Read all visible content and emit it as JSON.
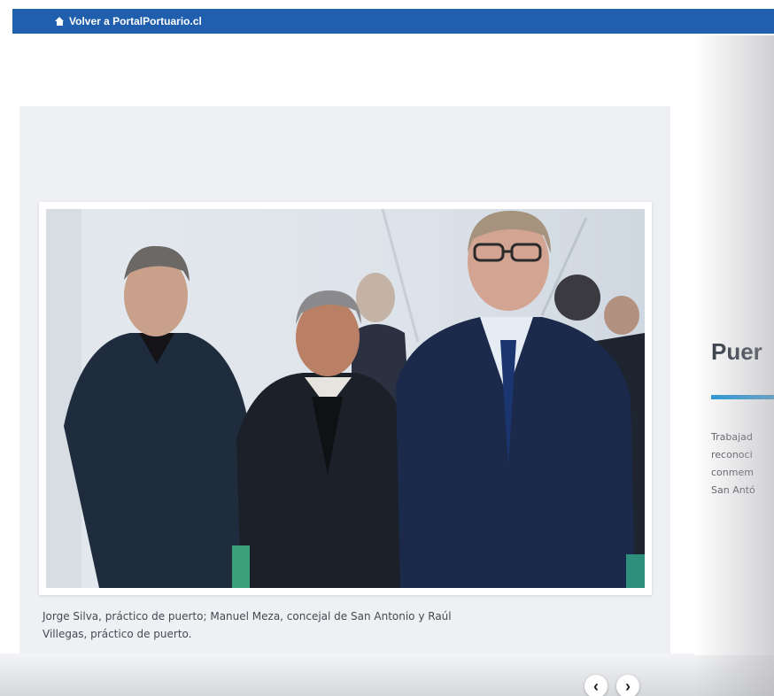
{
  "topbar": {
    "back_link": "Volver a PortalPortuario.cl",
    "icon": "home-icon",
    "color": "#1f5fad"
  },
  "gallery": {
    "caption_line1": "Jorge Silva, práctico de puerto; Manuel Meza, concejal de San Antonio y Raúl",
    "caption_line2": "Villegas, práctico de puerto.",
    "prev_icon": "chevron-left-icon",
    "next_icon": "chevron-right-icon",
    "prev_label": "‹",
    "next_label": "›"
  },
  "article": {
    "title": "Puer",
    "accent": "#2196d8",
    "lines": [
      "Trabajad",
      "reconoci",
      "conmem",
      "San Antó"
    ]
  }
}
